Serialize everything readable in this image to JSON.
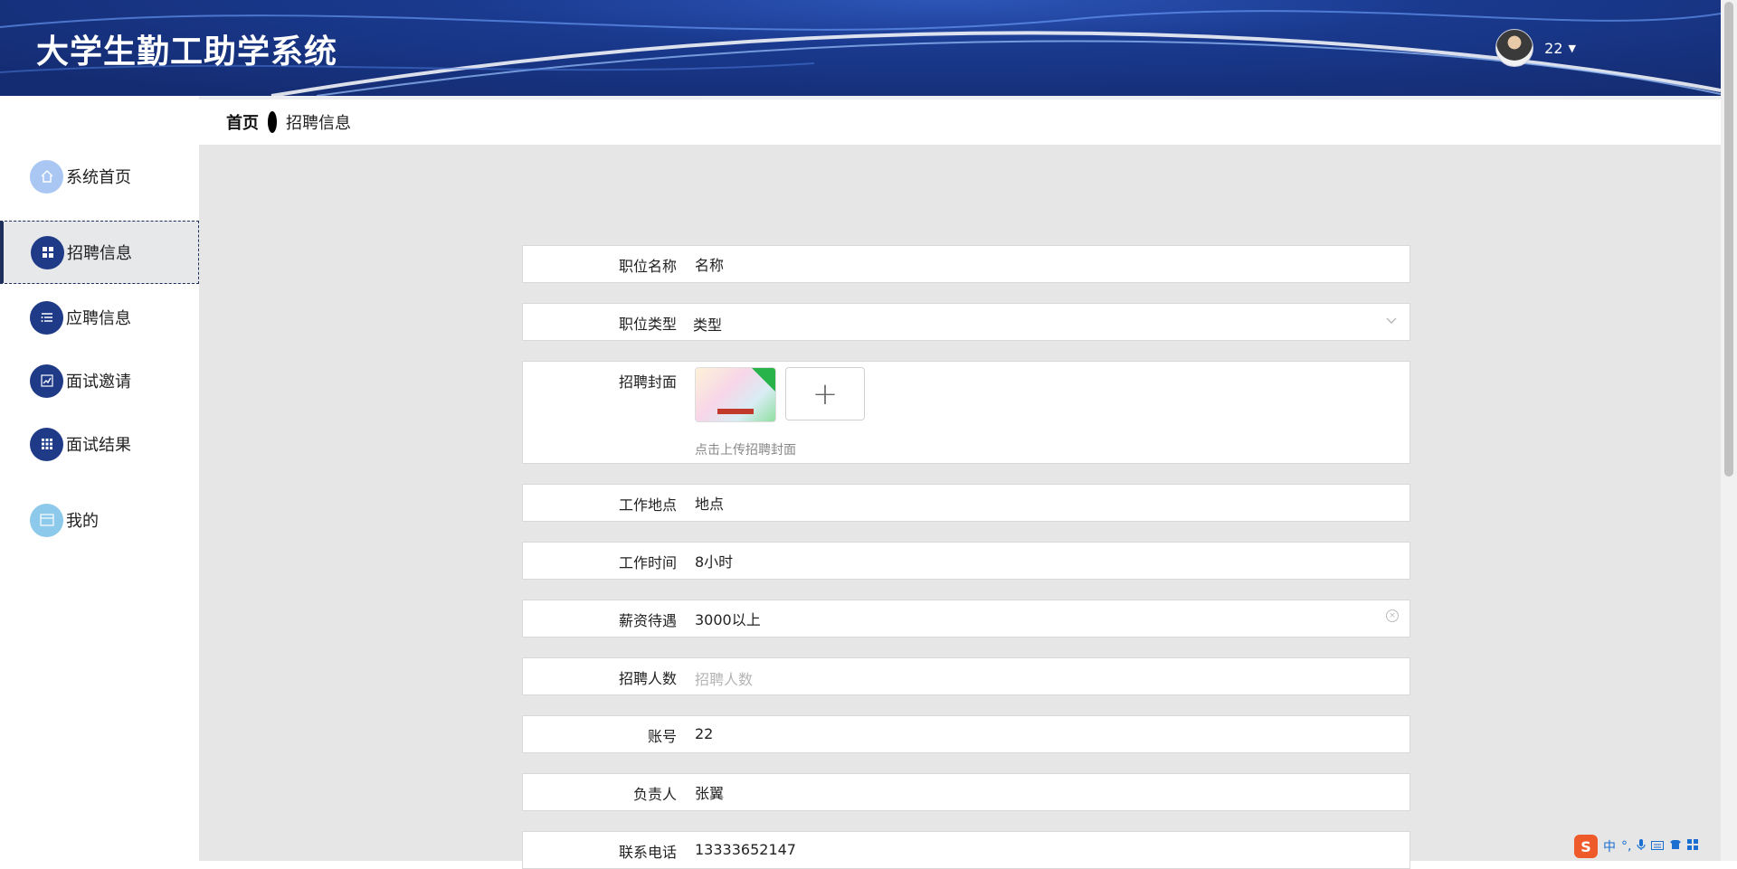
{
  "app": {
    "title": "大学生勤工助学系统"
  },
  "user": {
    "name": "22"
  },
  "sidebar": {
    "items": [
      {
        "label": "系统首页"
      },
      {
        "label": "招聘信息"
      },
      {
        "label": "应聘信息"
      },
      {
        "label": "面试邀请"
      },
      {
        "label": "面试结果"
      },
      {
        "label": "我的"
      }
    ]
  },
  "breadcrumb": {
    "home": "首页",
    "current": "招聘信息"
  },
  "form": {
    "job_name": {
      "label": "职位名称",
      "value": "名称"
    },
    "job_type": {
      "label": "职位类型",
      "value": "类型"
    },
    "cover": {
      "label": "招聘封面",
      "hint": "点击上传招聘封面",
      "add_symbol": "+"
    },
    "location": {
      "label": "工作地点",
      "value": "地点"
    },
    "hours": {
      "label": "工作时间",
      "value": "8小时"
    },
    "salary": {
      "label": "薪资待遇",
      "value": "3000以上"
    },
    "headcount": {
      "label": "招聘人数",
      "placeholder": "招聘人数"
    },
    "account": {
      "label": "账号",
      "value": "22"
    },
    "manager": {
      "label": "负责人",
      "value": "张翼"
    },
    "phone": {
      "label": "联系电话",
      "value": "13333652147"
    }
  },
  "ime": {
    "logo": "S",
    "lang": "中"
  },
  "colors": {
    "header_bg": "#1a3a8f",
    "nav_dark": "#1f3a87",
    "nav_light": "#a9c7f2",
    "main_bg": "#e6e6e6"
  }
}
